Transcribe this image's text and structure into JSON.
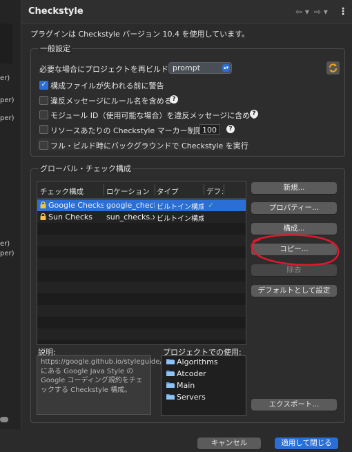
{
  "left_fragments": [
    "er)",
    "per)",
    "per)",
    "er)",
    "per)"
  ],
  "header": {
    "title": "Checkstyle",
    "nav_back": "⇦ ▾",
    "nav_forward": "⇨ ▾",
    "menu": "⋮"
  },
  "info_text": "プラグインは Checkstyle バージョン 10.4 を使用しています。",
  "general": {
    "label": "一般設定",
    "rebuild_label": "必要な場合にプロジェクトを再ビルド:",
    "rebuild_value": "prompt",
    "options": [
      {
        "label": "構成ファイルが失われる前に警告",
        "checked": true
      },
      {
        "label": "違反メッセージにルール名を含める",
        "checked": false
      },
      {
        "label": "モジュール ID（使用可能な場合）を違反メッセージに含める",
        "checked": false
      },
      {
        "label": "リソースあたりの Checkstyle マーカー制限",
        "checked": false
      },
      {
        "label": "フル・ビルド時にバックグラウンドで Checkstyle を実行",
        "checked": false
      }
    ],
    "marker_limit": "100",
    "help": "?"
  },
  "global": {
    "label": "グローバル・チェック構成",
    "columns": [
      "チェック構成",
      "ロケーション",
      "タイプ",
      "デフォ"
    ],
    "rows": [
      {
        "name": "Google Checks",
        "location": "google_checks.xml",
        "type": "ビルトイン構成",
        "default": "✓",
        "selected": true
      },
      {
        "name": "Sun Checks",
        "location": "sun_checks.xml",
        "type": "ビルトイン構成",
        "default": "",
        "selected": false
      }
    ],
    "buttons": {
      "new": "新規...",
      "properties": "プロパティー...",
      "configure": "構成...",
      "copy": "コピー...",
      "remove": "除去",
      "set_default": "デフォルトとして設定",
      "export": "エクスポート..."
    },
    "description_label": "説明:",
    "description": "https://google.github.io/styleguide/javaguide.html にある Google Java Style の Google コーディング規約をチェックする Checkstyle 構成。",
    "usage_label": "プロジェクトでの使用:",
    "usage": [
      "Algorithms",
      "Atcoder",
      "Main",
      "Servers"
    ]
  },
  "footer": {
    "cancel": "キャンセル",
    "apply_close": "適用して閉じる"
  },
  "colors": {
    "accent": "#2b6fd6",
    "annotation": "#e0182c"
  }
}
